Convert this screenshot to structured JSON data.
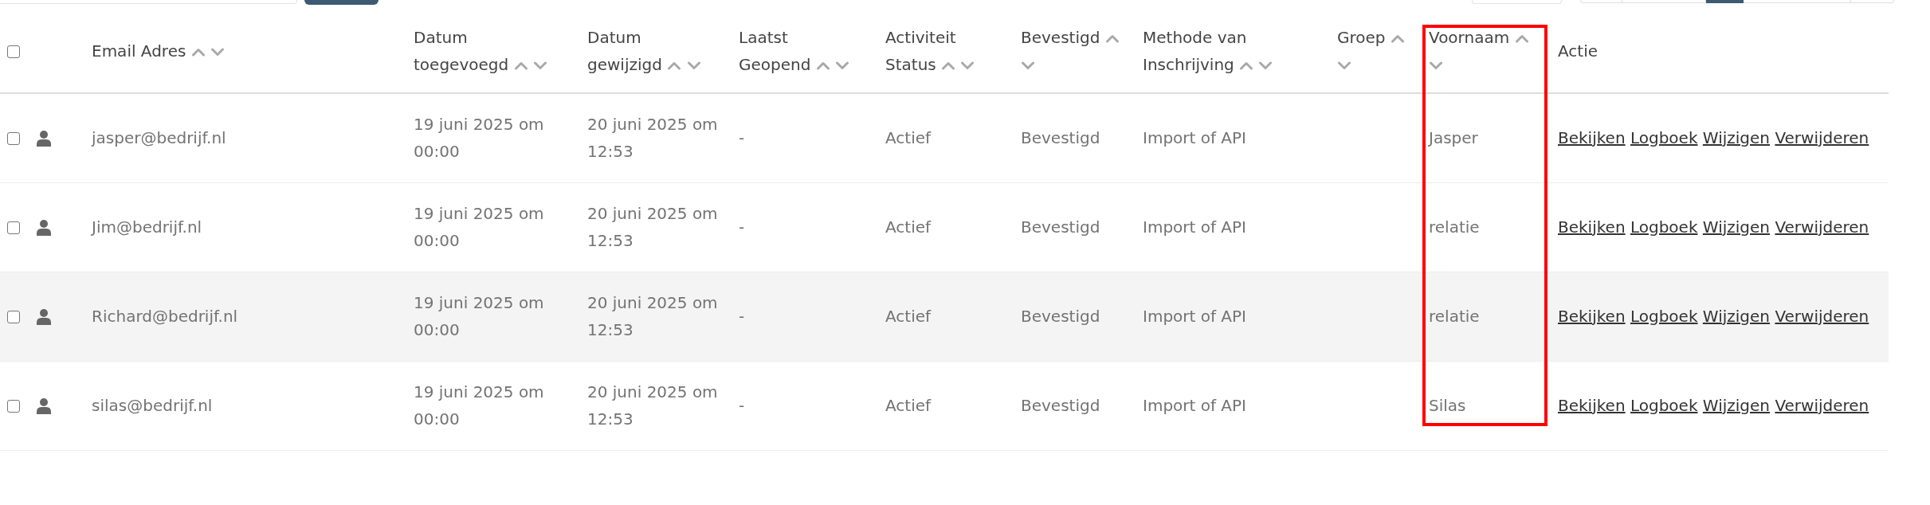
{
  "toolbar": {
    "left": [
      {
        "kind": "field"
      },
      {
        "kind": "button"
      }
    ],
    "right": [
      {
        "kind": "field"
      },
      {
        "kind": "pagination",
        "pages": [
          {
            "selected": false
          },
          {
            "selected": false
          },
          {
            "selected": true
          },
          {
            "selected": false
          },
          {
            "selected": false
          }
        ]
      }
    ]
  },
  "table": {
    "select_all": {
      "checked": false
    },
    "columns": [
      {
        "label": "Email Adres",
        "sortable": true,
        "highlighted": false
      },
      {
        "label": "Datum toegevoegd",
        "sortable": true,
        "highlighted": false
      },
      {
        "label": "Datum gewijzigd",
        "sortable": true,
        "highlighted": false
      },
      {
        "label": "Laatst Geopend",
        "sortable": true,
        "highlighted": false
      },
      {
        "label": "Activiteit Status",
        "sortable": true,
        "highlighted": false
      },
      {
        "label": "Bevestigd",
        "sortable": true,
        "highlighted": false
      },
      {
        "label": "Methode van Inschrijving",
        "sortable": true,
        "highlighted": false
      },
      {
        "label": "Groep",
        "sortable": true,
        "highlighted": false
      },
      {
        "label": "Voornaam",
        "sortable": true,
        "highlighted": true
      },
      {
        "label": "Actie",
        "sortable": false,
        "highlighted": false
      }
    ],
    "rows": [
      {
        "checked": false,
        "hovered": false,
        "cells": [
          "jasper@bedrijf.nl",
          "19 juni 2025 om 00:00",
          "20 juni 2025 om 12:53",
          "-",
          "Actief",
          "Bevestigd",
          "Import of API",
          null,
          "Jasper"
        ],
        "actions": [
          "Bekijken",
          "Logboek",
          "Wijzigen",
          "Verwijderen"
        ]
      },
      {
        "checked": false,
        "hovered": false,
        "cells": [
          "Jim@bedrijf.nl",
          "19 juni 2025 om 00:00",
          "20 juni 2025 om 12:53",
          "-",
          "Actief",
          "Bevestigd",
          "Import of API",
          null,
          "relatie"
        ],
        "actions": [
          "Bekijken",
          "Logboek",
          "Wijzigen",
          "Verwijderen"
        ]
      },
      {
        "checked": false,
        "hovered": true,
        "cells": [
          "Richard@bedrijf.nl",
          "19 juni 2025 om 00:00",
          "20 juni 2025 om 12:53",
          "-",
          "Actief",
          "Bevestigd",
          "Import of API",
          null,
          "relatie"
        ],
        "actions": [
          "Bekijken",
          "Logboek",
          "Wijzigen",
          "Verwijderen"
        ]
      },
      {
        "checked": false,
        "hovered": false,
        "cells": [
          "silas@bedrijf.nl",
          "19 juni 2025 om 00:00",
          "20 juni 2025 om 12:53",
          "-",
          "Actief",
          "Bevestigd",
          "Import of API",
          null,
          "Silas"
        ],
        "actions": [
          "Bekijken",
          "Logboek",
          "Wijzigen",
          "Verwijderen"
        ]
      }
    ]
  }
}
